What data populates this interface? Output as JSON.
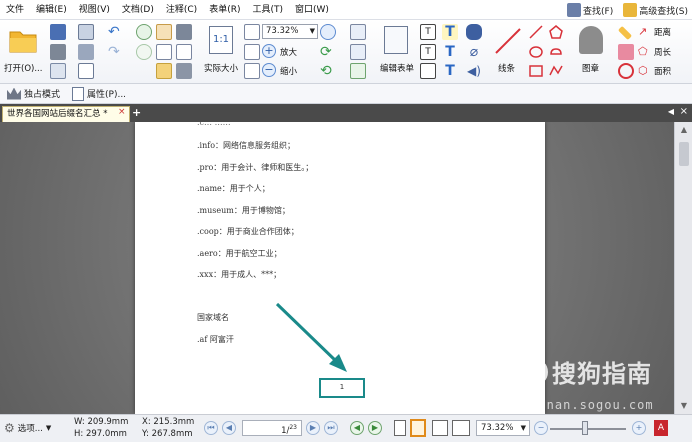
{
  "menu": {
    "items": [
      "文件",
      "编辑(E)",
      "视图(V)",
      "文档(D)",
      "注释(C)",
      "表单(R)",
      "工具(T)",
      "窗口(W)"
    ],
    "find_label": "查找(F)",
    "advanced_find_label": "高级查找(S)"
  },
  "ribbon": {
    "open_label": "打开(O)...",
    "actual_size_label": "实际大小",
    "zoom_value": "73.32%",
    "zoom_in_label": "放大",
    "zoom_out_label": "缩小",
    "edit_form_label": "编辑表单",
    "line_label": "线条",
    "stamp_label": "图章",
    "distance_label": "距离",
    "perimeter_label": "周长",
    "area_label": "面积"
  },
  "toolbar2": {
    "exclusive_mode_label": "独占模式",
    "properties_label": "属性(P)..."
  },
  "tab": {
    "title": "世界各国网站后缀名汇总 *",
    "close_glyph": "×",
    "add_glyph": "+"
  },
  "document": {
    "lines": [
      ".info：网络信息服务组织；",
      ".pro：用于会计、律师和医生。；",
      ".name：用于个人；",
      ".museum：用于博物馆；",
      ".coop：用于商业合作团体；",
      ".aero：用于航空工业；",
      ".xxx：用于成人、***；",
      "国家域名",
      ".af 阿富汗"
    ],
    "page_number": "1"
  },
  "watermark": {
    "main_text": "搜狗指南",
    "logo_letter": "S",
    "sub_text": "zhinan.sogou.com"
  },
  "statusbar": {
    "options_label": "选项...",
    "width_label": "W: 209.9mm",
    "height_label": "H: 297.0mm",
    "x_label": "X: 215.3mm",
    "y_label": "Y: 267.8mm",
    "current_page": "1",
    "total_pages": "23",
    "zoom_value": "73.32%"
  },
  "colors": {
    "highlight_teal": "#1a8a8a",
    "tab_bar": "#4a4a4a",
    "workspace": "#707070"
  }
}
